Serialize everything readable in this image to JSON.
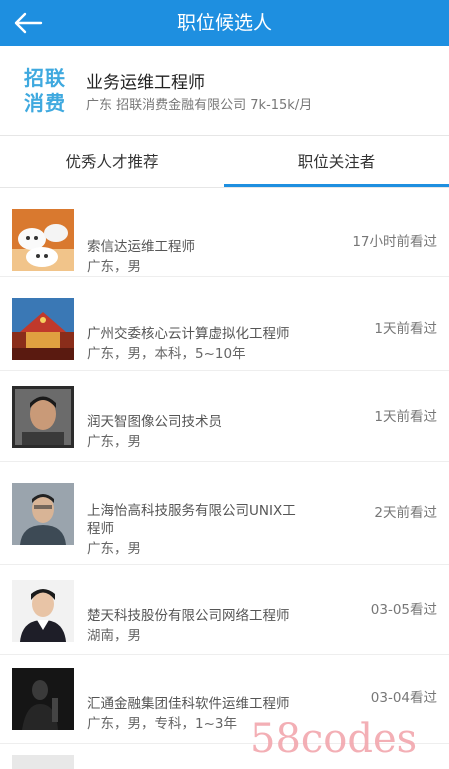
{
  "topbar": {
    "title": "职位候选人",
    "back_icon": "arrow-left-icon"
  },
  "job": {
    "logo_line1": "招联",
    "logo_line2": "消费",
    "title": "业务运维工程师",
    "meta": "广东 招联消费金融有限公司 7k-15k/月"
  },
  "tabs": [
    {
      "label": "优秀人才推荐"
    },
    {
      "label": "职位关注者"
    }
  ],
  "candidates": [
    {
      "name": "索信达运维工程师",
      "info": "广东，男",
      "time": "17小时前看过"
    },
    {
      "name": "广州交委核心云计算虚拟化工程师",
      "info": "广东，男，本科，5~10年",
      "time": "1天前看过"
    },
    {
      "name": "润天智图像公司技术员",
      "info": "广东，男",
      "time": "1天前看过"
    },
    {
      "name": "上海怡高科技服务有限公司UNIX工",
      "name2": "程师",
      "info": "广东，男",
      "time": "2天前看过"
    },
    {
      "name": "楚天科技股份有限公司网络工程师",
      "info": "湖南，男",
      "time": "03-05看过"
    },
    {
      "name": "汇通金融集团佳科软件运维工程师",
      "info": "广东，男，专科，1~3年",
      "time": "03-04看过"
    }
  ],
  "watermark": "58codes",
  "colors": {
    "accent": "#1e8fe0",
    "logo": "#3fa9df",
    "watermark": "#f2a7ae"
  }
}
